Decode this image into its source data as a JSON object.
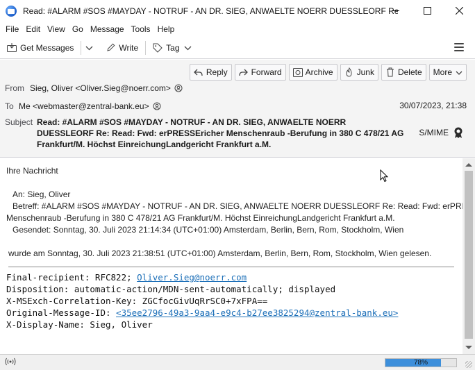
{
  "window": {
    "title": "Read: #ALARM #SOS #MAYDAY - NOTRUF - AN DR. SIEG, ANWAELTE NOERR DUESSLEORF Re: R...",
    "controls": {
      "minimize": "—",
      "maximize": "☐",
      "close": "✕"
    }
  },
  "menu": {
    "items": [
      {
        "label": "File"
      },
      {
        "label": "Edit"
      },
      {
        "label": "View"
      },
      {
        "label": "Go"
      },
      {
        "label": "Message"
      },
      {
        "label": "Tools"
      },
      {
        "label": "Help"
      }
    ]
  },
  "toolbar": {
    "get_messages": "Get Messages",
    "write": "Write",
    "tag": "Tag"
  },
  "header": {
    "actions": {
      "reply": "Reply",
      "forward": "Forward",
      "archive": "Archive",
      "junk": "Junk",
      "delete": "Delete",
      "more": "More"
    },
    "from_label": "From",
    "from_value": "Sieg, Oliver <Oliver.Sieg@noerr.com>",
    "to_label": "To",
    "to_value": "Me <webmaster@zentral-bank.eu>",
    "date": "30/07/2023, 21:38",
    "subject_label": "Subject",
    "subject": "Read: #ALARM #SOS #MAYDAY - NOTRUF - AN DR. SIEG, ANWAELTE NOERR DUESSLEORF Re: Read: Fwd: erPRESSEricher Menschenraub -Berufung in 380 C 478/21 AG Frankfurt/M. Höchst EinreichungLandgericht Frankfurt a.M.",
    "smime": "S/MIME"
  },
  "body": {
    "intro": "Ihre Nachricht",
    "to_line": "An: Sieg, Oliver",
    "subject_line": "Betreff: #ALARM #SOS #MAYDAY - NOTRUF - AN DR. SIEG, ANWAELTE NOERR DUESSLEORF Re: Read: Fwd: erPRESSEricher",
    "subject_line2": "Menschenraub -Berufung in 380 C 478/21 AG Frankfurt/M. Höchst EinreichungLandgericht Frankfurt a.M.",
    "sent_line": "Gesendet: Sonntag, 30. Juli 2023 21:14:34 (UTC+01:00) Amsterdam, Berlin, Bern, Rom, Stockholm, Wien",
    "read_line": "wurde am Sonntag, 30. Juli 2023 21:38:51 (UTC+01:00) Amsterdam, Berlin, Bern, Rom, Stockholm, Wien gelesen.",
    "final_recipient_prefix": "Final-recipient: RFC822; ",
    "final_recipient_link": "Oliver.Sieg@noerr.com",
    "disposition": "Disposition: automatic-action/MDN-sent-automatically; displayed",
    "correlation": "X-MSExch-Correlation-Key: ZGCfocGivUqRrSC0+7xFPA==",
    "original_id_prefix": "Original-Message-ID: ",
    "original_id_link": "<35ee2796-49a3-9aa4-e9c4-b27ee3825294@zentral-bank.eu>",
    "display_name": "X-Display-Name: Sieg, Oliver"
  },
  "status": {
    "progress_label": "78%",
    "progress_value": 0.78
  },
  "colors": {
    "link": "#1c6fb8",
    "progress": "#3d8fdb",
    "header_bg": "#f4f4f4"
  }
}
